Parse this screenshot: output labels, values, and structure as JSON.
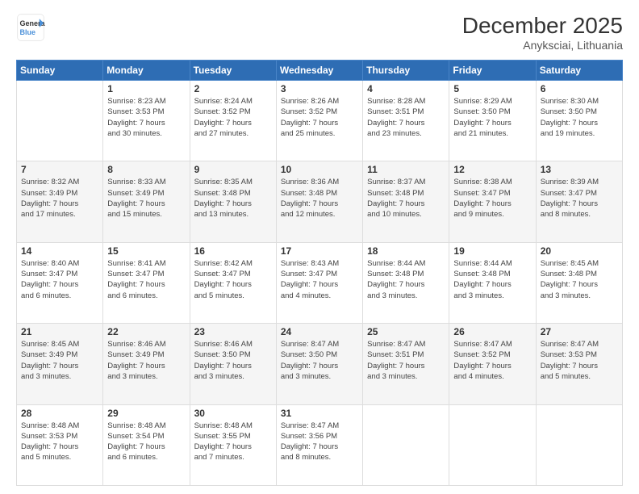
{
  "logo": {
    "line1": "General",
    "line2": "Blue"
  },
  "title": "December 2025",
  "subtitle": "Anyksciai, Lithuania",
  "days_of_week": [
    "Sunday",
    "Monday",
    "Tuesday",
    "Wednesday",
    "Thursday",
    "Friday",
    "Saturday"
  ],
  "weeks": [
    [
      {
        "day": "",
        "info": ""
      },
      {
        "day": "1",
        "info": "Sunrise: 8:23 AM\nSunset: 3:53 PM\nDaylight: 7 hours\nand 30 minutes."
      },
      {
        "day": "2",
        "info": "Sunrise: 8:24 AM\nSunset: 3:52 PM\nDaylight: 7 hours\nand 27 minutes."
      },
      {
        "day": "3",
        "info": "Sunrise: 8:26 AM\nSunset: 3:52 PM\nDaylight: 7 hours\nand 25 minutes."
      },
      {
        "day": "4",
        "info": "Sunrise: 8:28 AM\nSunset: 3:51 PM\nDaylight: 7 hours\nand 23 minutes."
      },
      {
        "day": "5",
        "info": "Sunrise: 8:29 AM\nSunset: 3:50 PM\nDaylight: 7 hours\nand 21 minutes."
      },
      {
        "day": "6",
        "info": "Sunrise: 8:30 AM\nSunset: 3:50 PM\nDaylight: 7 hours\nand 19 minutes."
      }
    ],
    [
      {
        "day": "7",
        "info": "Sunrise: 8:32 AM\nSunset: 3:49 PM\nDaylight: 7 hours\nand 17 minutes."
      },
      {
        "day": "8",
        "info": "Sunrise: 8:33 AM\nSunset: 3:49 PM\nDaylight: 7 hours\nand 15 minutes."
      },
      {
        "day": "9",
        "info": "Sunrise: 8:35 AM\nSunset: 3:48 PM\nDaylight: 7 hours\nand 13 minutes."
      },
      {
        "day": "10",
        "info": "Sunrise: 8:36 AM\nSunset: 3:48 PM\nDaylight: 7 hours\nand 12 minutes."
      },
      {
        "day": "11",
        "info": "Sunrise: 8:37 AM\nSunset: 3:48 PM\nDaylight: 7 hours\nand 10 minutes."
      },
      {
        "day": "12",
        "info": "Sunrise: 8:38 AM\nSunset: 3:47 PM\nDaylight: 7 hours\nand 9 minutes."
      },
      {
        "day": "13",
        "info": "Sunrise: 8:39 AM\nSunset: 3:47 PM\nDaylight: 7 hours\nand 8 minutes."
      }
    ],
    [
      {
        "day": "14",
        "info": "Sunrise: 8:40 AM\nSunset: 3:47 PM\nDaylight: 7 hours\nand 6 minutes."
      },
      {
        "day": "15",
        "info": "Sunrise: 8:41 AM\nSunset: 3:47 PM\nDaylight: 7 hours\nand 6 minutes."
      },
      {
        "day": "16",
        "info": "Sunrise: 8:42 AM\nSunset: 3:47 PM\nDaylight: 7 hours\nand 5 minutes."
      },
      {
        "day": "17",
        "info": "Sunrise: 8:43 AM\nSunset: 3:47 PM\nDaylight: 7 hours\nand 4 minutes."
      },
      {
        "day": "18",
        "info": "Sunrise: 8:44 AM\nSunset: 3:48 PM\nDaylight: 7 hours\nand 3 minutes."
      },
      {
        "day": "19",
        "info": "Sunrise: 8:44 AM\nSunset: 3:48 PM\nDaylight: 7 hours\nand 3 minutes."
      },
      {
        "day": "20",
        "info": "Sunrise: 8:45 AM\nSunset: 3:48 PM\nDaylight: 7 hours\nand 3 minutes."
      }
    ],
    [
      {
        "day": "21",
        "info": "Sunrise: 8:45 AM\nSunset: 3:49 PM\nDaylight: 7 hours\nand 3 minutes."
      },
      {
        "day": "22",
        "info": "Sunrise: 8:46 AM\nSunset: 3:49 PM\nDaylight: 7 hours\nand 3 minutes."
      },
      {
        "day": "23",
        "info": "Sunrise: 8:46 AM\nSunset: 3:50 PM\nDaylight: 7 hours\nand 3 minutes."
      },
      {
        "day": "24",
        "info": "Sunrise: 8:47 AM\nSunset: 3:50 PM\nDaylight: 7 hours\nand 3 minutes."
      },
      {
        "day": "25",
        "info": "Sunrise: 8:47 AM\nSunset: 3:51 PM\nDaylight: 7 hours\nand 3 minutes."
      },
      {
        "day": "26",
        "info": "Sunrise: 8:47 AM\nSunset: 3:52 PM\nDaylight: 7 hours\nand 4 minutes."
      },
      {
        "day": "27",
        "info": "Sunrise: 8:47 AM\nSunset: 3:53 PM\nDaylight: 7 hours\nand 5 minutes."
      }
    ],
    [
      {
        "day": "28",
        "info": "Sunrise: 8:48 AM\nSunset: 3:53 PM\nDaylight: 7 hours\nand 5 minutes."
      },
      {
        "day": "29",
        "info": "Sunrise: 8:48 AM\nSunset: 3:54 PM\nDaylight: 7 hours\nand 6 minutes."
      },
      {
        "day": "30",
        "info": "Sunrise: 8:48 AM\nSunset: 3:55 PM\nDaylight: 7 hours\nand 7 minutes."
      },
      {
        "day": "31",
        "info": "Sunrise: 8:47 AM\nSunset: 3:56 PM\nDaylight: 7 hours\nand 8 minutes."
      },
      {
        "day": "",
        "info": ""
      },
      {
        "day": "",
        "info": ""
      },
      {
        "day": "",
        "info": ""
      }
    ]
  ]
}
